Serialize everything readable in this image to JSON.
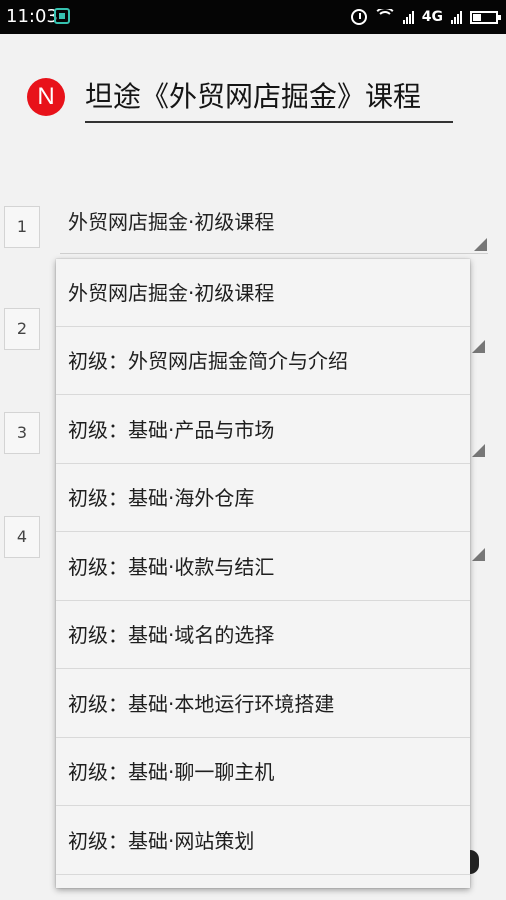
{
  "status_bar": {
    "time": "11:03",
    "network": "4G"
  },
  "header": {
    "logo_letter": "N",
    "title": "坦途《外贸网店掘金》课程",
    "logo_color": "#e8121a"
  },
  "selector": {
    "numbers": [
      "1",
      "2",
      "3",
      "4"
    ],
    "selected_label": "外贸网店掘金·初级课程"
  },
  "dropdown": {
    "options": [
      "外贸网店掘金·初级课程",
      "初级：外贸网店掘金简介与介绍",
      "初级：基础·产品与市场",
      "初级：基础·海外仓库",
      "初级：基础·收款与结汇",
      "初级：基础·域名的选择",
      "初级：基础·本地运行环境搭建",
      "初级：基础·聊一聊主机",
      "初级：基础·网站策划"
    ]
  }
}
